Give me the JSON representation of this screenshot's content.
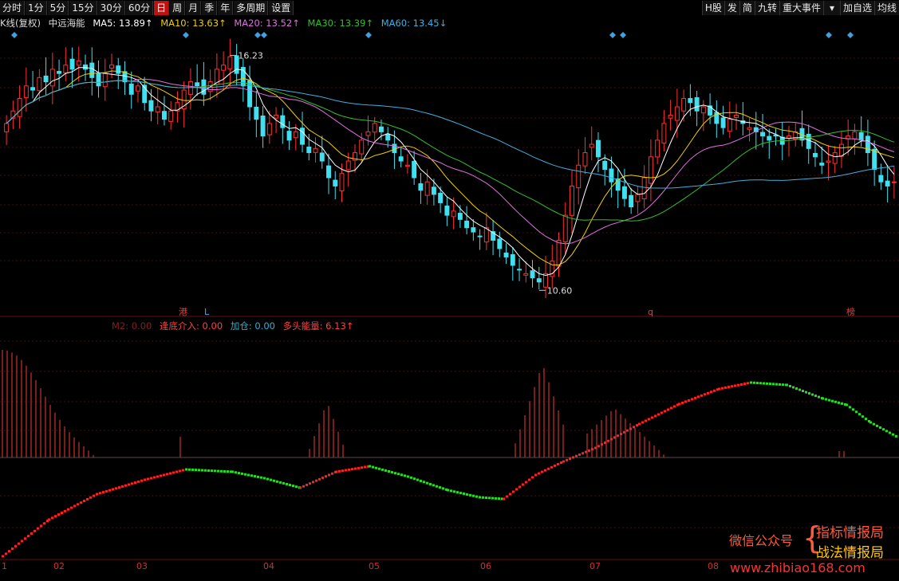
{
  "toolbar": {
    "left": [
      "分时",
      "1分",
      "5分",
      "15分",
      "30分",
      "60分",
      "日",
      "周",
      "月",
      "季",
      "年",
      "多周期",
      "设置"
    ],
    "active": "日",
    "right": [
      "H股",
      "发",
      "简",
      "九转",
      "重大事件",
      "加自选",
      "均线"
    ]
  },
  "legend": {
    "prefix": "K线(复权)",
    "name": "中远海能",
    "items": [
      {
        "label": "MA5: 13.89↑",
        "color": "#ffffff"
      },
      {
        "label": "MA10: 13.63↑",
        "color": "#f0d000"
      },
      {
        "label": "MA20: 13.52↑",
        "color": "#e070e0"
      },
      {
        "label": "MA30: 13.39↑",
        "color": "#30c030"
      },
      {
        "label": "MA60: 13.45↓",
        "color": "#40b0e0"
      }
    ]
  },
  "sub_legend": [
    {
      "label": "M2: 0.00",
      "color": "#802020"
    },
    {
      "label": "逢底介入: 0.00",
      "color": "#ff4040"
    },
    {
      "label": "加仓: 0.00",
      "color": "#30b0d0"
    },
    {
      "label": "多头能量: 6.13↑",
      "color": "#ff4040"
    }
  ],
  "markers": [
    {
      "text": "港",
      "color": "#ff3030"
    },
    {
      "text": "L",
      "color": "#30b0ff"
    },
    {
      "text": "q",
      "color": "#ff3030"
    },
    {
      "text": "榜",
      "color": "#ff3030"
    }
  ],
  "price_labels": {
    "high": "16.23",
    "low": "10.60"
  },
  "x_labels": [
    "1",
    "02",
    "03",
    "04",
    "05",
    "06",
    "07",
    "08"
  ],
  "watermark": {
    "left": "微信公众号",
    "line1": "指标情报局",
    "line2": "战法情报局",
    "url": "www.zhibiao168.com"
  },
  "colors": {
    "up": "#ff3030",
    "down": "#40e0f0",
    "grid": "#4a0d0d",
    "bar": "#c83030"
  },
  "chart_data": {
    "type": "candlestick",
    "title": "中远海能",
    "ylim": [
      10.3,
      16.7
    ],
    "high": 16.23,
    "low": 10.6,
    "closes": [
      14.6,
      14.9,
      15.2,
      15.5,
      15.4,
      15.7,
      15.6,
      15.9,
      15.8,
      16.0,
      15.9,
      16.1,
      15.9,
      15.7,
      15.5,
      15.8,
      16.0,
      15.8,
      15.6,
      15.3,
      15.5,
      15.1,
      14.9,
      15.0,
      14.7,
      14.9,
      15.1,
      15.4,
      15.6,
      15.5,
      15.3,
      15.6,
      15.9,
      16.0,
      16.2,
      15.8,
      15.5,
      15.0,
      14.7,
      14.3,
      14.6,
      14.8,
      14.5,
      14.2,
      14.4,
      14.1,
      13.9,
      14.0,
      13.7,
      13.3,
      13.1,
      13.4,
      13.7,
      13.9,
      14.2,
      14.4,
      14.6,
      14.4,
      14.2,
      13.9,
      13.7,
      13.6,
      13.3,
      13.0,
      13.2,
      12.9,
      12.7,
      12.4,
      12.5,
      12.3,
      12.1,
      12.0,
      11.9,
      12.1,
      11.8,
      11.6,
      11.4,
      11.2,
      11.1,
      11.0,
      10.9,
      10.8,
      11.0,
      11.3,
      11.8,
      12.4,
      13.1,
      13.6,
      13.9,
      14.1,
      13.8,
      13.5,
      13.2,
      13.0,
      12.8,
      12.6,
      12.9,
      13.3,
      13.8,
      14.2,
      14.6,
      14.8,
      15.0,
      15.2,
      15.1,
      14.9,
      15.0,
      14.8,
      14.6,
      14.5,
      14.7,
      14.8,
      14.6,
      14.5,
      14.4,
      14.3,
      14.2,
      14.3,
      14.1,
      14.3,
      14.4,
      14.2,
      14.0,
      13.8,
      13.6,
      13.7,
      13.9,
      14.1,
      14.3,
      14.4,
      14.2,
      13.9,
      13.5,
      13.2,
      13.1,
      13.2
    ]
  }
}
